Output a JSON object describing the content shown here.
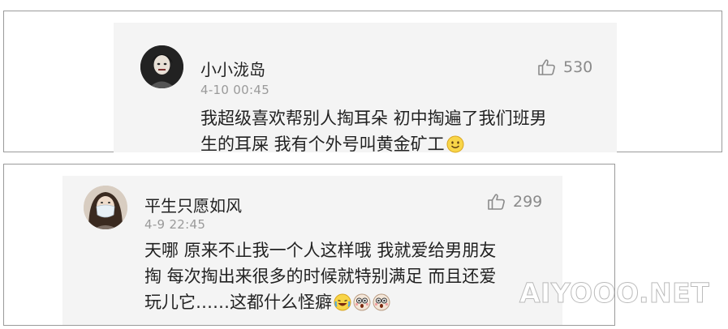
{
  "comments": [
    {
      "username": "小小泷岛",
      "timestamp": "4-10 00:45",
      "likes": "530",
      "text_lines": [
        "我超级喜欢帮别人掏耳朵 初中掏遍了我们班男",
        "生的耳屎 我有个外号叫黄金矿工"
      ],
      "emojis": [
        "smile-emoji"
      ]
    },
    {
      "username": "平生只愿如风",
      "timestamp": "4-9 22:45",
      "likes": "299",
      "text_lines": [
        "天哪 原来不止我一个人这样哦 我就爱给男朋友",
        "掏 每次掏出来很多的时候就特别满足 而且还爱",
        "玩儿它……这都什么怪癖"
      ],
      "emojis": [
        "laugh-cry-emoji",
        "shocked-face-emoji",
        "shocked-face-emoji"
      ]
    }
  ],
  "watermark": "AIYOOO.NET",
  "colors": {
    "card_bg": "#f4f4f4",
    "frame_border": "#9a9a9a",
    "timestamp": "#9a9a9a",
    "text": "#222222"
  },
  "icons": [
    "thumb-up-icon"
  ]
}
